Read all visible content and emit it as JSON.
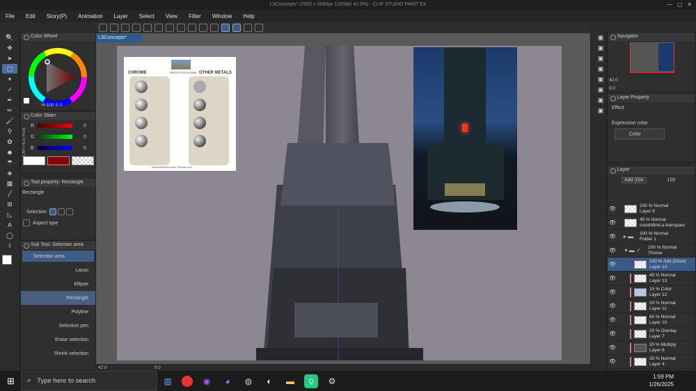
{
  "window": {
    "title": "LSConcepts* (2920 x 2080px 1200dpi 42.0%) - CLIP STUDIO PAINT EX"
  },
  "menu": [
    "File",
    "Edit",
    "Story(P)",
    "Animation",
    "Layer",
    "Select",
    "View",
    "Filter",
    "Window",
    "Help"
  ],
  "document_tab": "LSConcepts*",
  "color_wheel": {
    "title": "Color Wheel",
    "values": [
      "H",
      "100",
      "S",
      "0"
    ]
  },
  "color_slider": {
    "title": "Color Slider",
    "modes": [
      "RGB",
      "HLS",
      "CMY"
    ],
    "channels": [
      {
        "label": "R",
        "value": "0"
      },
      {
        "label": "G",
        "value": "0"
      },
      {
        "label": "B",
        "value": "0"
      }
    ]
  },
  "tool_property": {
    "title": "Tool property: Rectangle",
    "tool_name": "Rectangle",
    "selection_label": "Selection",
    "aspect_label": "Aspect type"
  },
  "sub_tool": {
    "title": "Sub Tool: Selection area",
    "group": "Selection area",
    "items": [
      "Lasso",
      "Ellipse",
      "Rectangle",
      "Polyline",
      "Selection pen",
      "Erase selection",
      "Shrink selection"
    ]
  },
  "reference_sheet": {
    "title_left": "CHROME",
    "title_mid": "REFLECTED SCENE",
    "title_right": "OTHER METALS",
    "footer": "AllsortofReferences Tutorial.com"
  },
  "status_bar": {
    "zoom": "42.0",
    "rotation": "0.0"
  },
  "navigator": {
    "title": "Navigator",
    "zoom": "42.0",
    "angle": "0.0"
  },
  "layer_property": {
    "title": "Layer Property",
    "effect_label": "Effect",
    "expression_label": "Expression color",
    "expression_value": "Color"
  },
  "layer_panel": {
    "title": "Layer",
    "blend_mode": "Add (Glo",
    "opacity": "100",
    "layers": [
      {
        "mode": "100 % Normal",
        "name": "Layer 9"
      },
      {
        "mode": "45 % Normal",
        "name": "couldnfind-a-transpare"
      },
      {
        "mode": "100 % Normal",
        "name": "Folder 1"
      },
      {
        "mode": "100 % Normal",
        "name": "Throne"
      },
      {
        "mode": "100 % Add (Glow)",
        "name": "Layer 14"
      },
      {
        "mode": "45 % Normal",
        "name": "Layer 13"
      },
      {
        "mode": "15 % Color",
        "name": "Layer 12"
      },
      {
        "mode": "20 % Normal",
        "name": "Layer 11"
      },
      {
        "mode": "65 % Normal",
        "name": "Layer 10"
      },
      {
        "mode": "20 % Overlay",
        "name": "Layer 7"
      },
      {
        "mode": "20 % Multiply",
        "name": "Layer 6"
      },
      {
        "mode": "35 % Normal",
        "name": "Layer 4"
      }
    ]
  },
  "taskbar": {
    "search_placeholder": "Type here to search",
    "time": "1:59 PM",
    "date": "1/26/2025"
  }
}
